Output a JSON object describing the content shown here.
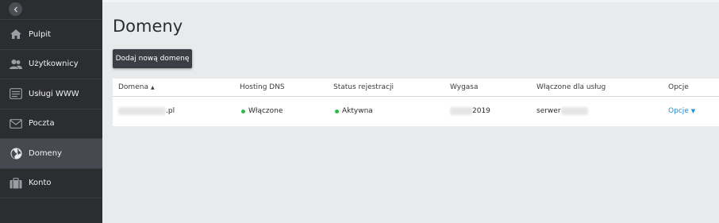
{
  "sidebar": {
    "items": [
      {
        "label": "Pulpit",
        "icon": "home-icon"
      },
      {
        "label": "Użytkownicy",
        "icon": "users-icon"
      },
      {
        "label": "Usługi WWW",
        "icon": "www-services-icon"
      },
      {
        "label": "Poczta",
        "icon": "mail-icon"
      },
      {
        "label": "Domeny",
        "icon": "globe-icon",
        "active": true
      },
      {
        "label": "Konto",
        "icon": "briefcase-icon"
      }
    ]
  },
  "main": {
    "title": "Domeny",
    "add_button": "Dodaj nową domenę",
    "table": {
      "headers": {
        "domain": "Domena",
        "hosting_dns": "Hosting DNS",
        "status": "Status rejestracji",
        "expires": "Wygasa",
        "enabled_for": "Włączone dla usług",
        "options": "Opcje"
      },
      "rows": [
        {
          "domain_suffix": ".pl",
          "hosting_dns": "Włączone",
          "status": "Aktywna",
          "expires_suffix": "2019",
          "enabled_for_prefix": "serwer",
          "options": "Opcje"
        }
      ]
    }
  },
  "colors": {
    "sidebar_bg": "#2b2d30",
    "sidebar_active": "#464a50",
    "accent_link": "#1f8fd6",
    "status_green": "#2db84d"
  }
}
